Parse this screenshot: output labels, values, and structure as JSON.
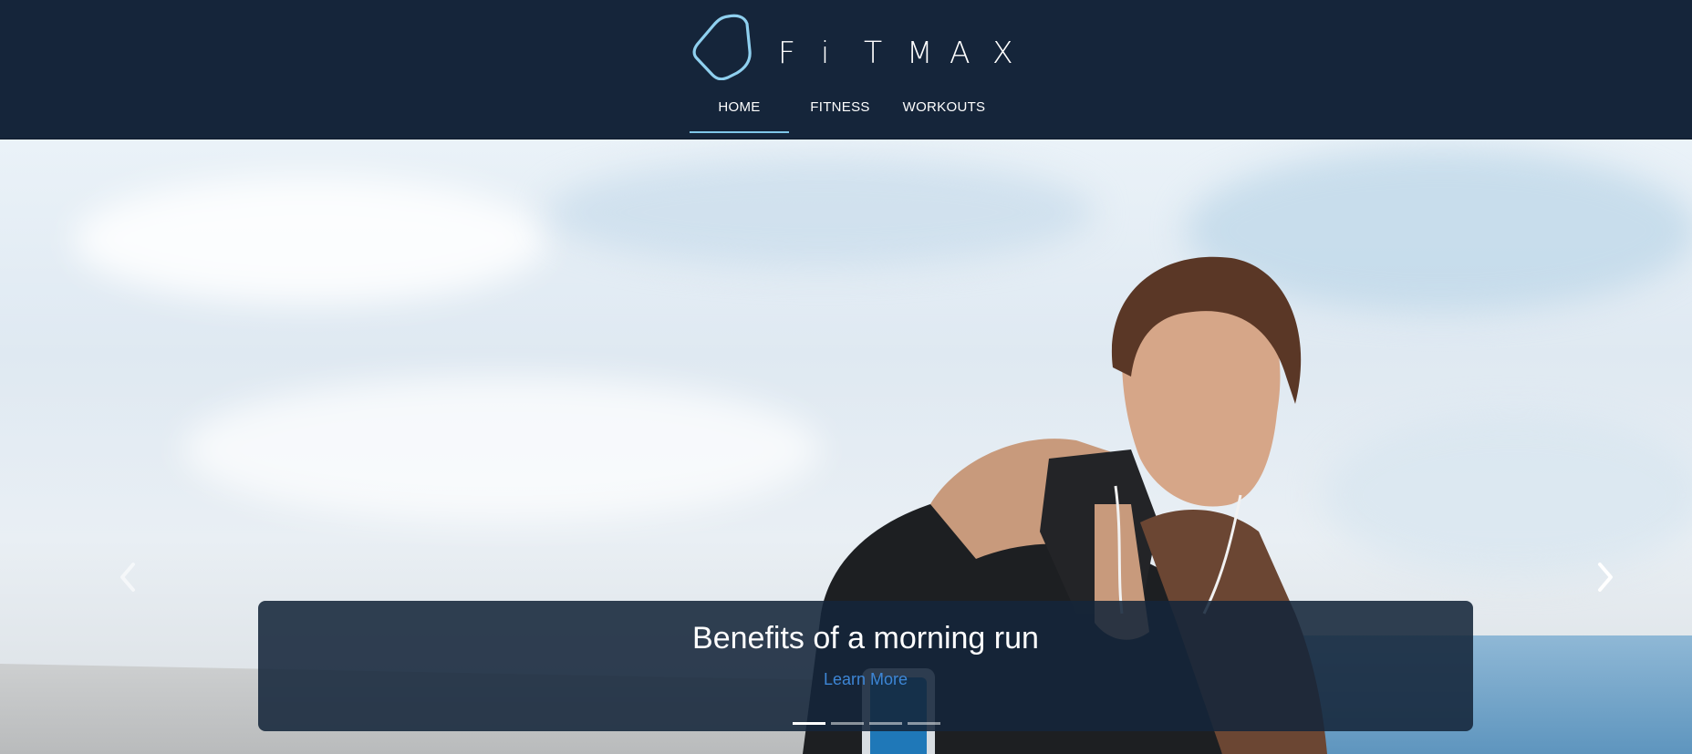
{
  "brand": {
    "logo_letters": [
      "F",
      "i",
      "T",
      "M",
      "A",
      "X"
    ]
  },
  "nav": {
    "items": [
      {
        "label": "HOME",
        "active": true
      },
      {
        "label": "FITNESS",
        "active": false
      },
      {
        "label": "WORKOUTS",
        "active": false
      }
    ]
  },
  "carousel": {
    "prev_icon": "chevron-left-icon",
    "next_icon": "chevron-right-icon",
    "slide": {
      "title": "Benefits of a morning run",
      "link_label": "Learn More"
    },
    "slide_count": 4,
    "active_slide": 1
  },
  "colors": {
    "header_bg": "#15253a",
    "accent": "#7fc6e8",
    "link": "#3d86d6"
  }
}
